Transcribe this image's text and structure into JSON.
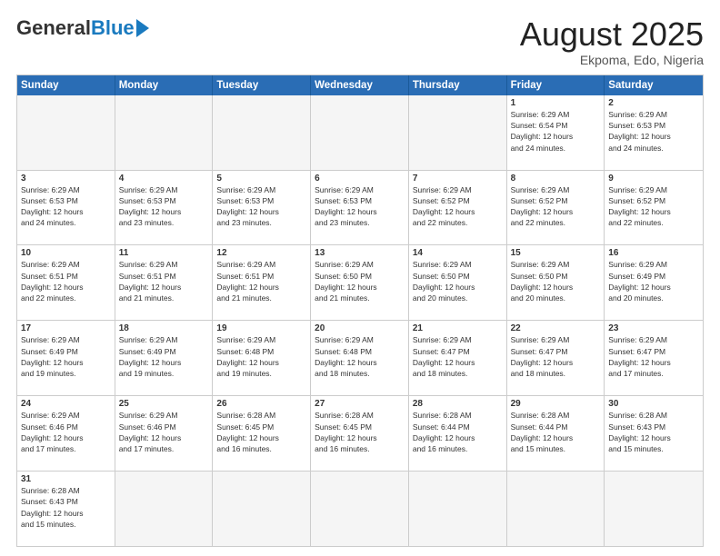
{
  "logo": {
    "general": "General",
    "blue": "Blue"
  },
  "title": "August 2025",
  "subtitle": "Ekpoma, Edo, Nigeria",
  "header_days": [
    "Sunday",
    "Monday",
    "Tuesday",
    "Wednesday",
    "Thursday",
    "Friday",
    "Saturday"
  ],
  "weeks": [
    [
      {
        "day": "",
        "empty": true
      },
      {
        "day": "",
        "empty": true
      },
      {
        "day": "",
        "empty": true
      },
      {
        "day": "",
        "empty": true
      },
      {
        "day": "",
        "empty": true
      },
      {
        "day": "1",
        "lines": [
          "Sunrise: 6:29 AM",
          "Sunset: 6:54 PM",
          "Daylight: 12 hours",
          "and 24 minutes."
        ]
      },
      {
        "day": "2",
        "lines": [
          "Sunrise: 6:29 AM",
          "Sunset: 6:53 PM",
          "Daylight: 12 hours",
          "and 24 minutes."
        ]
      }
    ],
    [
      {
        "day": "3",
        "lines": [
          "Sunrise: 6:29 AM",
          "Sunset: 6:53 PM",
          "Daylight: 12 hours",
          "and 24 minutes."
        ]
      },
      {
        "day": "4",
        "lines": [
          "Sunrise: 6:29 AM",
          "Sunset: 6:53 PM",
          "Daylight: 12 hours",
          "and 23 minutes."
        ]
      },
      {
        "day": "5",
        "lines": [
          "Sunrise: 6:29 AM",
          "Sunset: 6:53 PM",
          "Daylight: 12 hours",
          "and 23 minutes."
        ]
      },
      {
        "day": "6",
        "lines": [
          "Sunrise: 6:29 AM",
          "Sunset: 6:53 PM",
          "Daylight: 12 hours",
          "and 23 minutes."
        ]
      },
      {
        "day": "7",
        "lines": [
          "Sunrise: 6:29 AM",
          "Sunset: 6:52 PM",
          "Daylight: 12 hours",
          "and 22 minutes."
        ]
      },
      {
        "day": "8",
        "lines": [
          "Sunrise: 6:29 AM",
          "Sunset: 6:52 PM",
          "Daylight: 12 hours",
          "and 22 minutes."
        ]
      },
      {
        "day": "9",
        "lines": [
          "Sunrise: 6:29 AM",
          "Sunset: 6:52 PM",
          "Daylight: 12 hours",
          "and 22 minutes."
        ]
      }
    ],
    [
      {
        "day": "10",
        "lines": [
          "Sunrise: 6:29 AM",
          "Sunset: 6:51 PM",
          "Daylight: 12 hours",
          "and 22 minutes."
        ]
      },
      {
        "day": "11",
        "lines": [
          "Sunrise: 6:29 AM",
          "Sunset: 6:51 PM",
          "Daylight: 12 hours",
          "and 21 minutes."
        ]
      },
      {
        "day": "12",
        "lines": [
          "Sunrise: 6:29 AM",
          "Sunset: 6:51 PM",
          "Daylight: 12 hours",
          "and 21 minutes."
        ]
      },
      {
        "day": "13",
        "lines": [
          "Sunrise: 6:29 AM",
          "Sunset: 6:50 PM",
          "Daylight: 12 hours",
          "and 21 minutes."
        ]
      },
      {
        "day": "14",
        "lines": [
          "Sunrise: 6:29 AM",
          "Sunset: 6:50 PM",
          "Daylight: 12 hours",
          "and 20 minutes."
        ]
      },
      {
        "day": "15",
        "lines": [
          "Sunrise: 6:29 AM",
          "Sunset: 6:50 PM",
          "Daylight: 12 hours",
          "and 20 minutes."
        ]
      },
      {
        "day": "16",
        "lines": [
          "Sunrise: 6:29 AM",
          "Sunset: 6:49 PM",
          "Daylight: 12 hours",
          "and 20 minutes."
        ]
      }
    ],
    [
      {
        "day": "17",
        "lines": [
          "Sunrise: 6:29 AM",
          "Sunset: 6:49 PM",
          "Daylight: 12 hours",
          "and 19 minutes."
        ]
      },
      {
        "day": "18",
        "lines": [
          "Sunrise: 6:29 AM",
          "Sunset: 6:49 PM",
          "Daylight: 12 hours",
          "and 19 minutes."
        ]
      },
      {
        "day": "19",
        "lines": [
          "Sunrise: 6:29 AM",
          "Sunset: 6:48 PM",
          "Daylight: 12 hours",
          "and 19 minutes."
        ]
      },
      {
        "day": "20",
        "lines": [
          "Sunrise: 6:29 AM",
          "Sunset: 6:48 PM",
          "Daylight: 12 hours",
          "and 18 minutes."
        ]
      },
      {
        "day": "21",
        "lines": [
          "Sunrise: 6:29 AM",
          "Sunset: 6:47 PM",
          "Daylight: 12 hours",
          "and 18 minutes."
        ]
      },
      {
        "day": "22",
        "lines": [
          "Sunrise: 6:29 AM",
          "Sunset: 6:47 PM",
          "Daylight: 12 hours",
          "and 18 minutes."
        ]
      },
      {
        "day": "23",
        "lines": [
          "Sunrise: 6:29 AM",
          "Sunset: 6:47 PM",
          "Daylight: 12 hours",
          "and 17 minutes."
        ]
      }
    ],
    [
      {
        "day": "24",
        "lines": [
          "Sunrise: 6:29 AM",
          "Sunset: 6:46 PM",
          "Daylight: 12 hours",
          "and 17 minutes."
        ]
      },
      {
        "day": "25",
        "lines": [
          "Sunrise: 6:29 AM",
          "Sunset: 6:46 PM",
          "Daylight: 12 hours",
          "and 17 minutes."
        ]
      },
      {
        "day": "26",
        "lines": [
          "Sunrise: 6:28 AM",
          "Sunset: 6:45 PM",
          "Daylight: 12 hours",
          "and 16 minutes."
        ]
      },
      {
        "day": "27",
        "lines": [
          "Sunrise: 6:28 AM",
          "Sunset: 6:45 PM",
          "Daylight: 12 hours",
          "and 16 minutes."
        ]
      },
      {
        "day": "28",
        "lines": [
          "Sunrise: 6:28 AM",
          "Sunset: 6:44 PM",
          "Daylight: 12 hours",
          "and 16 minutes."
        ]
      },
      {
        "day": "29",
        "lines": [
          "Sunrise: 6:28 AM",
          "Sunset: 6:44 PM",
          "Daylight: 12 hours",
          "and 15 minutes."
        ]
      },
      {
        "day": "30",
        "lines": [
          "Sunrise: 6:28 AM",
          "Sunset: 6:43 PM",
          "Daylight: 12 hours",
          "and 15 minutes."
        ]
      }
    ],
    [
      {
        "day": "31",
        "lines": [
          "Sunrise: 6:28 AM",
          "Sunset: 6:43 PM",
          "Daylight: 12 hours",
          "and 15 minutes."
        ]
      },
      {
        "day": "",
        "empty": true
      },
      {
        "day": "",
        "empty": true
      },
      {
        "day": "",
        "empty": true
      },
      {
        "day": "",
        "empty": true
      },
      {
        "day": "",
        "empty": true
      },
      {
        "day": "",
        "empty": true
      }
    ]
  ]
}
